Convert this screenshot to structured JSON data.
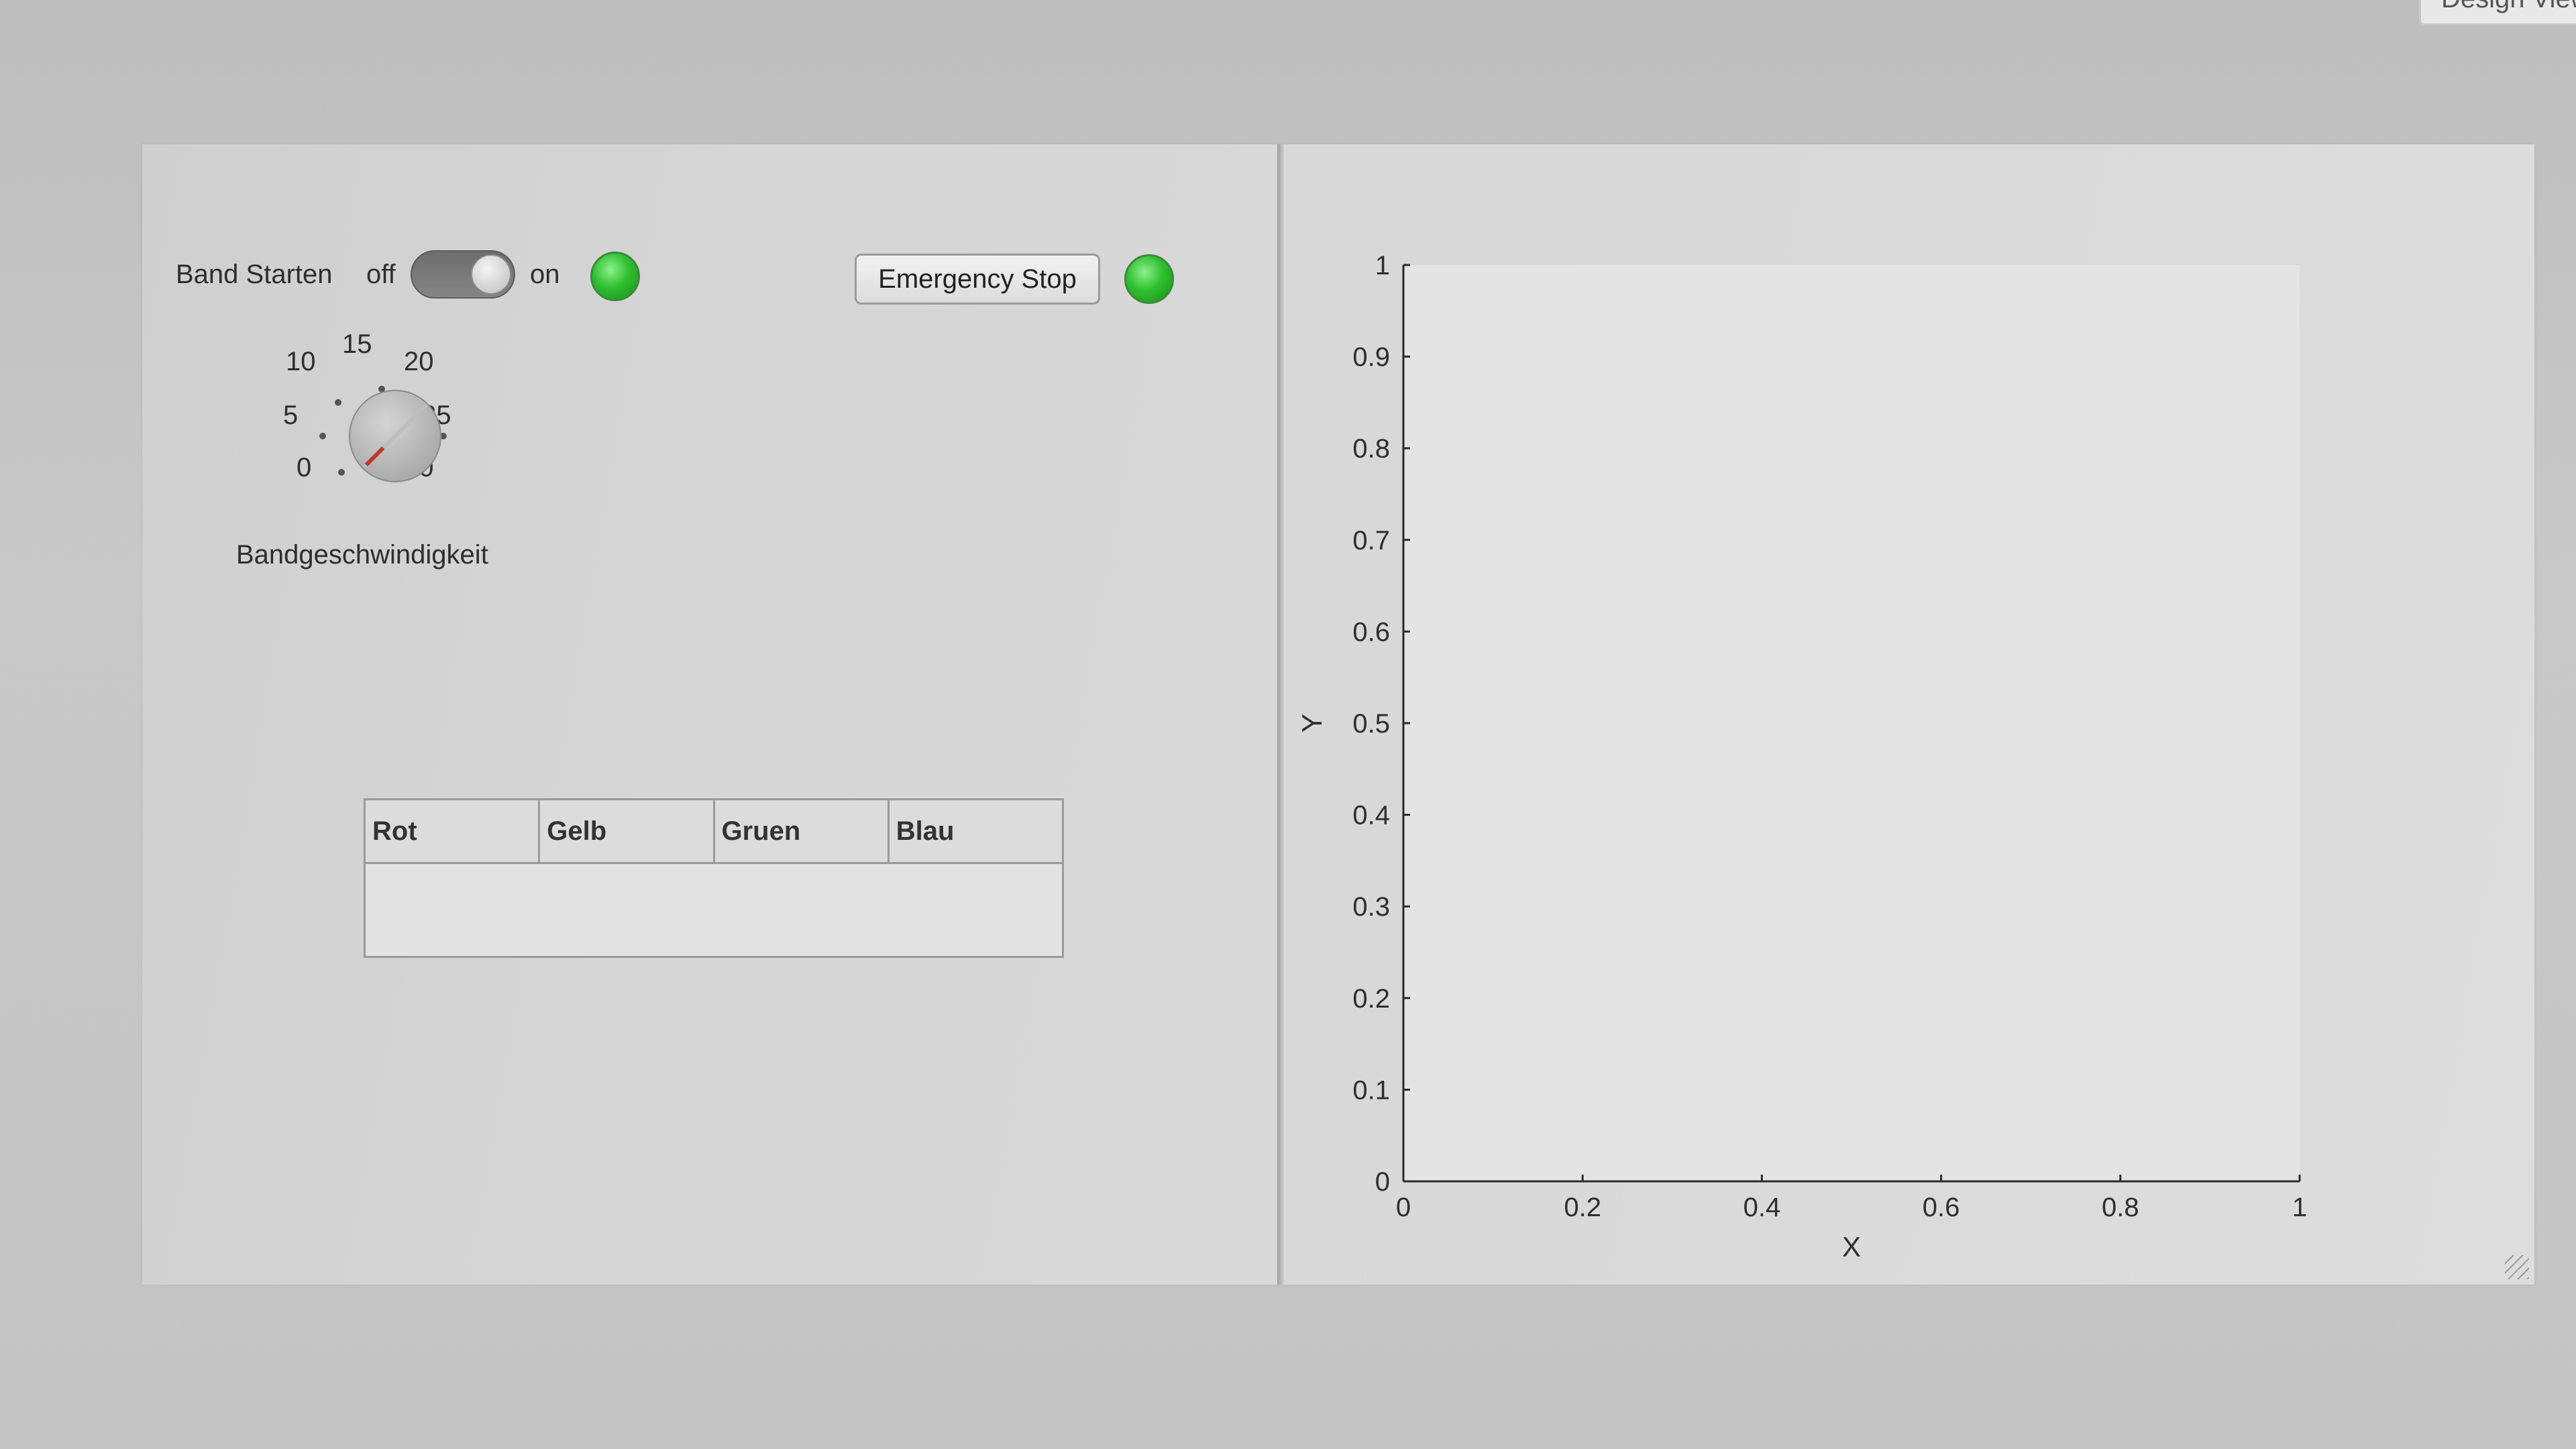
{
  "window": {
    "tab_label": "Design View"
  },
  "controls": {
    "band_label": "Band Starten",
    "switch_off": "off",
    "switch_on": "on",
    "switch_state": "on",
    "emergency_button": "Emergency Stop",
    "lamp_color": "#2fc02f"
  },
  "knob": {
    "ticks": [
      "0",
      "5",
      "10",
      "15",
      "20",
      "25",
      "30"
    ],
    "value": 0,
    "label": "Bandgeschwindigkeit"
  },
  "table": {
    "columns": [
      "Rot",
      "Gelb",
      "Gruen",
      "Blau"
    ],
    "rows": []
  },
  "chart_data": {
    "type": "line",
    "series": [],
    "xlabel": "X",
    "ylabel": "Y",
    "xlim": [
      0,
      1
    ],
    "ylim": [
      0,
      1
    ],
    "x_ticks": [
      "0",
      "0.2",
      "0.4",
      "0.6",
      "0.8",
      "1"
    ],
    "y_ticks": [
      "0",
      "0.1",
      "0.2",
      "0.3",
      "0.4",
      "0.5",
      "0.6",
      "0.7",
      "0.8",
      "0.9",
      "1"
    ],
    "grid": false
  }
}
